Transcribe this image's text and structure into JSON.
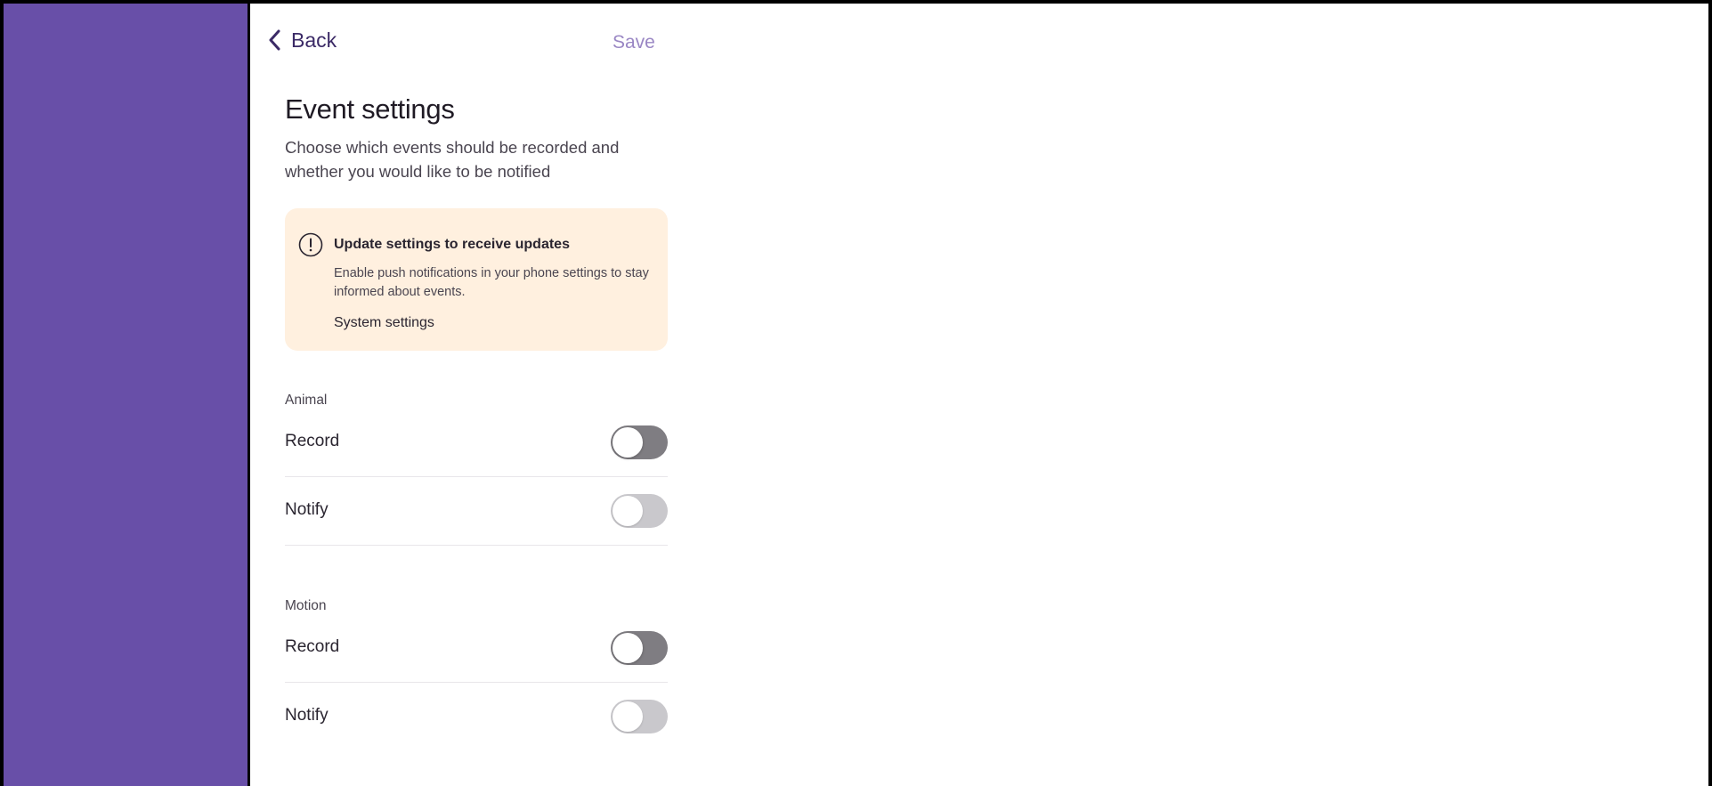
{
  "nav": {
    "back_label": "Back",
    "save_label": "Save"
  },
  "page": {
    "title": "Event settings",
    "subtitle": "Choose which events should be recorded and whether you would like to be notified"
  },
  "alert": {
    "icon": "exclamation-circle-icon",
    "title": "Update settings to receive updates",
    "description": "Enable push notifications in your phone settings to stay informed about events.",
    "link_label": "System settings"
  },
  "sections": [
    {
      "label": "Animal",
      "rows": [
        {
          "label": "Record",
          "toggle_on": false,
          "enabled": true
        },
        {
          "label": "Notify",
          "toggle_on": false,
          "enabled": false
        }
      ]
    },
    {
      "label": "Motion",
      "rows": [
        {
          "label": "Record",
          "toggle_on": false,
          "enabled": true
        },
        {
          "label": "Notify",
          "toggle_on": false,
          "enabled": false
        }
      ]
    }
  ],
  "colors": {
    "sidebar": "#684fa8",
    "accent": "#3b2a66",
    "save_disabled": "#9a87c4",
    "alert_bg": "#fff0df",
    "toggle_enabled_off": "#7f7d82",
    "toggle_disabled": "#c9c8cc"
  }
}
